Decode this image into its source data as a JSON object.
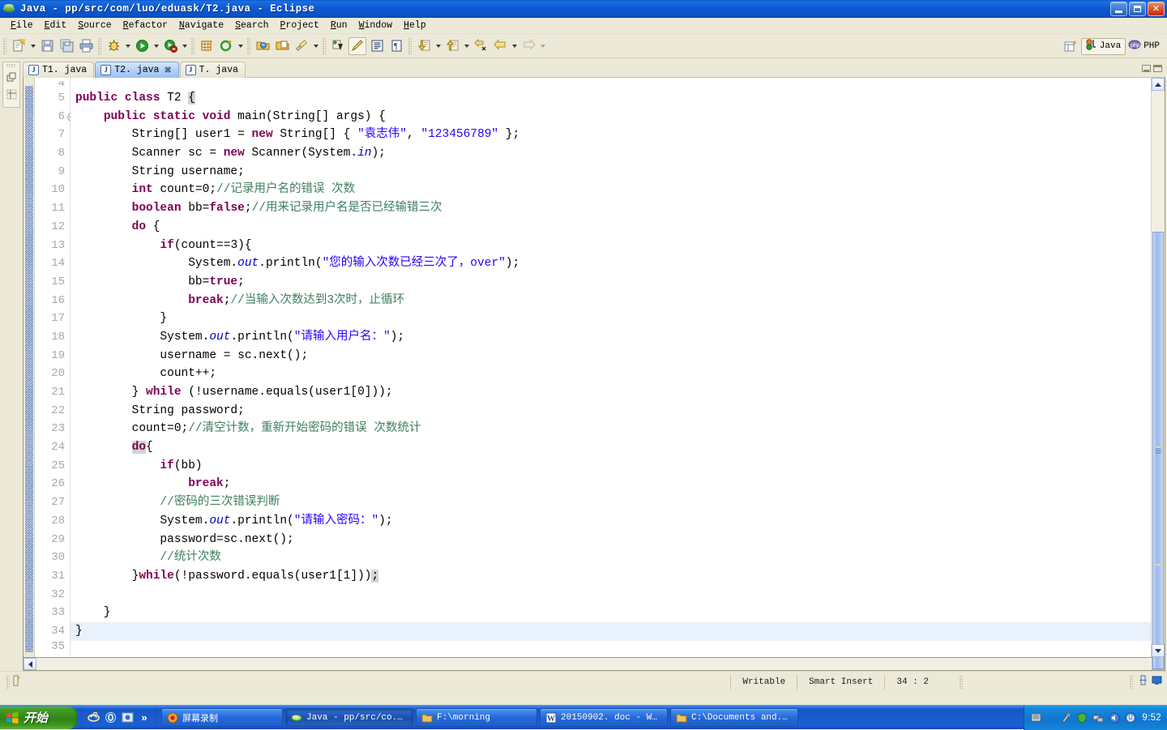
{
  "window": {
    "title": "Java - pp/src/com/luo/eduask/T2.java - Eclipse",
    "icon": "eclipse-icon",
    "buttons": {
      "minimize": "Minimize",
      "restore": "Restore",
      "close": "Close"
    }
  },
  "menubar": {
    "items": [
      "File",
      "Edit",
      "Source",
      "Refactor",
      "Navigate",
      "Search",
      "Project",
      "Run",
      "Window",
      "Help"
    ]
  },
  "toolbar": {
    "groups": [
      {
        "buttons": [
          {
            "name": "new-icon",
            "label": "New",
            "dropdown": true
          },
          {
            "name": "save-icon",
            "label": "Save",
            "dropdown": false
          },
          {
            "name": "save-all-icon",
            "label": "Save All",
            "dropdown": false
          },
          {
            "name": "print-icon",
            "label": "Print",
            "dropdown": false
          }
        ]
      },
      {
        "buttons": [
          {
            "name": "debug-icon",
            "label": "Debug",
            "dropdown": true
          },
          {
            "name": "run-icon",
            "label": "Run",
            "dropdown": true
          },
          {
            "name": "run-external-tools-icon",
            "label": "External Tools",
            "dropdown": true
          }
        ]
      },
      {
        "buttons": [
          {
            "name": "new-java-project-icon",
            "label": "New Java Project",
            "dropdown": false
          },
          {
            "name": "new-class-icon",
            "label": "New Java Class",
            "dropdown": true
          }
        ]
      },
      {
        "buttons": [
          {
            "name": "open-type-icon",
            "label": "Open Type",
            "dropdown": false
          },
          {
            "name": "open-task-icon",
            "label": "Open Task",
            "dropdown": false
          },
          {
            "name": "search-icon",
            "label": "Search",
            "dropdown": true
          }
        ]
      },
      {
        "buttons": [
          {
            "name": "next-annotation-icon",
            "label": "Next Annotation",
            "dropdown": false
          },
          {
            "name": "pencil-icon",
            "label": "Toggle Mark Occurrences",
            "dropdown": false,
            "pressed": true
          },
          {
            "name": "show-whitespace-icon",
            "label": "Show Whitespace Characters",
            "dropdown": false
          },
          {
            "name": "block-selection-icon",
            "label": "Block Selection Mode",
            "dropdown": false
          }
        ]
      },
      {
        "buttons": [
          {
            "name": "next-annotation-down-icon",
            "label": "Next Annotation",
            "dropdown": true
          },
          {
            "name": "previous-annotation-up-icon",
            "label": "Previous Annotation",
            "dropdown": true
          },
          {
            "name": "last-edit-location-icon",
            "label": "Last Edit Location",
            "dropdown": false
          },
          {
            "name": "back-icon",
            "label": "Back",
            "dropdown": true
          },
          {
            "name": "forward-icon",
            "label": "Forward",
            "dropdown": true
          }
        ]
      }
    ],
    "perspective": {
      "open_perspective_label": "Open Perspective",
      "items": [
        {
          "name": "perspective-java",
          "label": "Java",
          "active": true
        },
        {
          "name": "perspective-php",
          "label": "PHP",
          "active": false
        }
      ]
    }
  },
  "fastview": {
    "icons": [
      "restore-view-icon",
      "package-explorer-icon"
    ]
  },
  "editor": {
    "tabs": [
      {
        "label": "T1. java",
        "active": false,
        "closable": false
      },
      {
        "label": "T2. java",
        "active": true,
        "closable": true
      },
      {
        "label": "T. java",
        "active": false,
        "closable": false
      }
    ],
    "close_glyph": "✖",
    "minimize_label": "Minimize",
    "maximize_label": "Maximize",
    "first_partial_line": "4",
    "last_partial_line": "35",
    "lines": [
      {
        "num": "5",
        "fold": false,
        "current": false,
        "tokens": [
          {
            "t": "kw",
            "v": "public class "
          },
          {
            "t": "p",
            "v": "T2 "
          },
          {
            "t": "caret",
            "v": "{"
          }
        ]
      },
      {
        "num": "6",
        "fold": true,
        "current": false,
        "tokens": [
          {
            "t": "p",
            "v": "    "
          },
          {
            "t": "kw",
            "v": "public static void "
          },
          {
            "t": "p",
            "v": "main(String[] args) {"
          }
        ]
      },
      {
        "num": "7",
        "fold": false,
        "current": false,
        "tokens": [
          {
            "t": "p",
            "v": "        String[] user1 = "
          },
          {
            "t": "kw",
            "v": "new "
          },
          {
            "t": "p",
            "v": "String[] { "
          },
          {
            "t": "str",
            "v": "\"袁志伟\""
          },
          {
            "t": "p",
            "v": ", "
          },
          {
            "t": "str",
            "v": "\"123456789\""
          },
          {
            "t": "p",
            "v": " };"
          }
        ]
      },
      {
        "num": "8",
        "fold": false,
        "current": false,
        "tokens": [
          {
            "t": "p",
            "v": "        Scanner sc = "
          },
          {
            "t": "kw",
            "v": "new "
          },
          {
            "t": "p",
            "v": "Scanner(System."
          },
          {
            "t": "fld",
            "v": "in"
          },
          {
            "t": "p",
            "v": ");"
          }
        ]
      },
      {
        "num": "9",
        "fold": false,
        "current": false,
        "tokens": [
          {
            "t": "p",
            "v": "        String username;"
          }
        ]
      },
      {
        "num": "10",
        "fold": false,
        "current": false,
        "tokens": [
          {
            "t": "p",
            "v": "        "
          },
          {
            "t": "kw",
            "v": "int "
          },
          {
            "t": "p",
            "v": "count=0;"
          },
          {
            "t": "cmt",
            "v": "//记录用户名的错误 次数"
          }
        ]
      },
      {
        "num": "11",
        "fold": false,
        "current": false,
        "tokens": [
          {
            "t": "p",
            "v": "        "
          },
          {
            "t": "kw",
            "v": "boolean "
          },
          {
            "t": "p",
            "v": "bb="
          },
          {
            "t": "kw",
            "v": "false"
          },
          {
            "t": "p",
            "v": ";"
          },
          {
            "t": "cmt",
            "v": "//用来记录用户名是否已经输错三次"
          }
        ]
      },
      {
        "num": "12",
        "fold": false,
        "current": false,
        "tokens": [
          {
            "t": "p",
            "v": "        "
          },
          {
            "t": "kw",
            "v": "do"
          },
          {
            "t": "p",
            "v": " {"
          }
        ]
      },
      {
        "num": "13",
        "fold": false,
        "current": false,
        "tokens": [
          {
            "t": "p",
            "v": "            "
          },
          {
            "t": "kw",
            "v": "if"
          },
          {
            "t": "p",
            "v": "(count==3){"
          }
        ]
      },
      {
        "num": "14",
        "fold": false,
        "current": false,
        "tokens": [
          {
            "t": "p",
            "v": "                System."
          },
          {
            "t": "fld",
            "v": "out"
          },
          {
            "t": "p",
            "v": ".println("
          },
          {
            "t": "str",
            "v": "\"您的输入次数已经三次了，over\""
          },
          {
            "t": "p",
            "v": ");"
          }
        ]
      },
      {
        "num": "15",
        "fold": false,
        "current": false,
        "tokens": [
          {
            "t": "p",
            "v": "                bb="
          },
          {
            "t": "kw",
            "v": "true"
          },
          {
            "t": "p",
            "v": ";"
          }
        ]
      },
      {
        "num": "16",
        "fold": false,
        "current": false,
        "tokens": [
          {
            "t": "p",
            "v": "                "
          },
          {
            "t": "kw",
            "v": "break"
          },
          {
            "t": "p",
            "v": ";"
          },
          {
            "t": "cmt",
            "v": "//当输入次数达到3次时，止循环"
          }
        ]
      },
      {
        "num": "17",
        "fold": false,
        "current": false,
        "tokens": [
          {
            "t": "p",
            "v": "            }"
          }
        ]
      },
      {
        "num": "18",
        "fold": false,
        "current": false,
        "tokens": [
          {
            "t": "p",
            "v": "            System."
          },
          {
            "t": "fld",
            "v": "out"
          },
          {
            "t": "p",
            "v": ".println("
          },
          {
            "t": "str",
            "v": "\"请输入用户名：\""
          },
          {
            "t": "p",
            "v": ");"
          }
        ]
      },
      {
        "num": "19",
        "fold": false,
        "current": false,
        "tokens": [
          {
            "t": "p",
            "v": "            username = sc.next();"
          }
        ]
      },
      {
        "num": "20",
        "fold": false,
        "current": false,
        "tokens": [
          {
            "t": "p",
            "v": "            count++;"
          }
        ]
      },
      {
        "num": "21",
        "fold": false,
        "current": false,
        "tokens": [
          {
            "t": "p",
            "v": "        } "
          },
          {
            "t": "kw",
            "v": "while"
          },
          {
            "t": "p",
            "v": " (!username.equals(user1[0]));"
          }
        ]
      },
      {
        "num": "22",
        "fold": false,
        "current": false,
        "tokens": [
          {
            "t": "p",
            "v": "        String password;"
          }
        ]
      },
      {
        "num": "23",
        "fold": false,
        "current": false,
        "tokens": [
          {
            "t": "p",
            "v": "        count=0;"
          },
          {
            "t": "cmt",
            "v": "//清空计数，重新开始密码的错误 次数统计"
          }
        ]
      },
      {
        "num": "24",
        "fold": false,
        "current": false,
        "tokens": [
          {
            "t": "p",
            "v": "        "
          },
          {
            "t": "kwocc",
            "v": "do"
          },
          {
            "t": "p",
            "v": "{"
          }
        ]
      },
      {
        "num": "25",
        "fold": false,
        "current": false,
        "tokens": [
          {
            "t": "p",
            "v": "            "
          },
          {
            "t": "kw",
            "v": "if"
          },
          {
            "t": "p",
            "v": "(bb)"
          }
        ]
      },
      {
        "num": "26",
        "fold": false,
        "current": false,
        "tokens": [
          {
            "t": "p",
            "v": "                "
          },
          {
            "t": "kw",
            "v": "break"
          },
          {
            "t": "p",
            "v": ";"
          }
        ]
      },
      {
        "num": "27",
        "fold": false,
        "current": false,
        "tokens": [
          {
            "t": "p",
            "v": "            "
          },
          {
            "t": "cmt",
            "v": "//密码的三次错误判断"
          }
        ]
      },
      {
        "num": "28",
        "fold": false,
        "current": false,
        "tokens": [
          {
            "t": "p",
            "v": "            System."
          },
          {
            "t": "fld",
            "v": "out"
          },
          {
            "t": "p",
            "v": ".println("
          },
          {
            "t": "str",
            "v": "\"请输入密码：\""
          },
          {
            "t": "p",
            "v": ");"
          }
        ]
      },
      {
        "num": "29",
        "fold": false,
        "current": false,
        "tokens": [
          {
            "t": "p",
            "v": "            password=sc.next();"
          }
        ]
      },
      {
        "num": "30",
        "fold": false,
        "current": false,
        "tokens": [
          {
            "t": "p",
            "v": "            "
          },
          {
            "t": "cmt",
            "v": "//统计次数"
          }
        ]
      },
      {
        "num": "31",
        "fold": false,
        "current": false,
        "tokens": [
          {
            "t": "p",
            "v": "        }"
          },
          {
            "t": "kw",
            "v": "while"
          },
          {
            "t": "p",
            "v": "(!password.equals(user1[1]))"
          },
          {
            "t": "caret",
            "v": ";"
          }
        ]
      },
      {
        "num": "32",
        "fold": false,
        "current": false,
        "tokens": []
      },
      {
        "num": "33",
        "fold": false,
        "current": false,
        "tokens": [
          {
            "t": "p",
            "v": "    }"
          }
        ]
      },
      {
        "num": "34",
        "fold": false,
        "current": true,
        "tokens": [
          {
            "t": "p",
            "v": "}"
          }
        ]
      }
    ]
  },
  "statusbar": {
    "left_icon": "writable-indicator-icon",
    "cells": [
      {
        "name": "writable-status",
        "value": "Writable"
      },
      {
        "name": "insert-mode-status",
        "value": "Smart Insert"
      },
      {
        "name": "cursor-position-status",
        "value": "34 : 2"
      }
    ],
    "right_icons": [
      "link-editor-icon",
      "presentation-icon"
    ]
  },
  "taskbar": {
    "start_label": "开始",
    "quick_launch": [
      "ie-icon",
      "outlook-icon",
      "media-icon",
      "chevron-more-icon"
    ],
    "tasks": [
      {
        "icon": "screen-record-icon",
        "label": "屏幕录制",
        "active": false
      },
      {
        "icon": "eclipse-icon",
        "label": "Java - pp/src/co...",
        "active": true
      },
      {
        "icon": "folder-icon",
        "label": "F:\\morning",
        "active": false
      },
      {
        "icon": "word-icon",
        "label": "20150902. doc - W...",
        "active": false
      },
      {
        "icon": "folder-icon",
        "label": "C:\\Documents and...",
        "active": false
      }
    ],
    "tray": {
      "icons": [
        "keyboard-icon",
        "input-method-icon",
        "shield-icon",
        "network-icon",
        "sound-icon",
        "power-icon"
      ],
      "clock": "9:52"
    }
  },
  "colors": {
    "title_bar": "#0E5BD6",
    "keyword": "#7F0055",
    "string": "#2A00FF",
    "comment": "#3F7F5F",
    "field": "#0000C0",
    "current_line": "#E8F1FC",
    "chrome": "#ECE9D8"
  }
}
